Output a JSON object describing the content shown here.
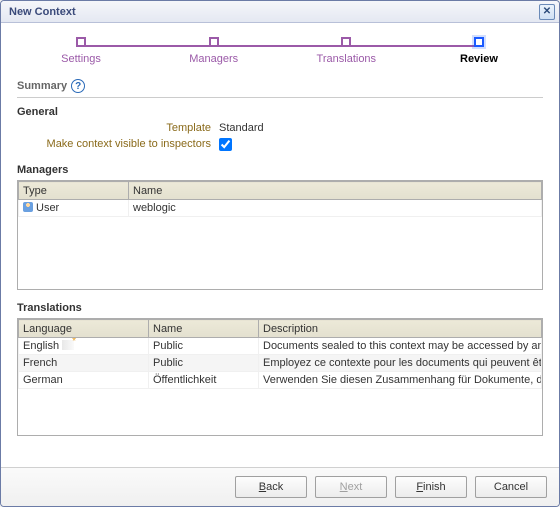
{
  "dialog": {
    "title": "New Context"
  },
  "wizard": {
    "steps": [
      {
        "label": "Settings"
      },
      {
        "label": "Managers"
      },
      {
        "label": "Translations"
      },
      {
        "label": "Review"
      }
    ],
    "active_index": 3
  },
  "summary_label": "Summary",
  "general": {
    "title": "General",
    "template_label": "Template",
    "template_value": "Standard",
    "visible_label": "Make context visible to inspectors",
    "visible_checked": true
  },
  "managers": {
    "title": "Managers",
    "columns": {
      "type": "Type",
      "name": "Name"
    },
    "rows": [
      {
        "type": "User",
        "name": "weblogic"
      }
    ]
  },
  "translations": {
    "title": "Translations",
    "columns": {
      "language": "Language",
      "name": "Name",
      "description": "Description"
    },
    "rows": [
      {
        "language": "English",
        "is_default": true,
        "name": "Public",
        "description": "Documents sealed to this context may be accessed by anyone."
      },
      {
        "language": "French",
        "is_default": false,
        "name": "Public",
        "description": "Employez ce contexte pour les documents qui peuvent être accédés."
      },
      {
        "language": "German",
        "is_default": false,
        "name": "Öffentlichkeit",
        "description": "Verwenden Sie diesen Zusammenhang für Dokumente, die durch."
      }
    ]
  },
  "buttons": {
    "back": "Back",
    "next": "Next",
    "finish": "Finish",
    "cancel": "Cancel"
  }
}
